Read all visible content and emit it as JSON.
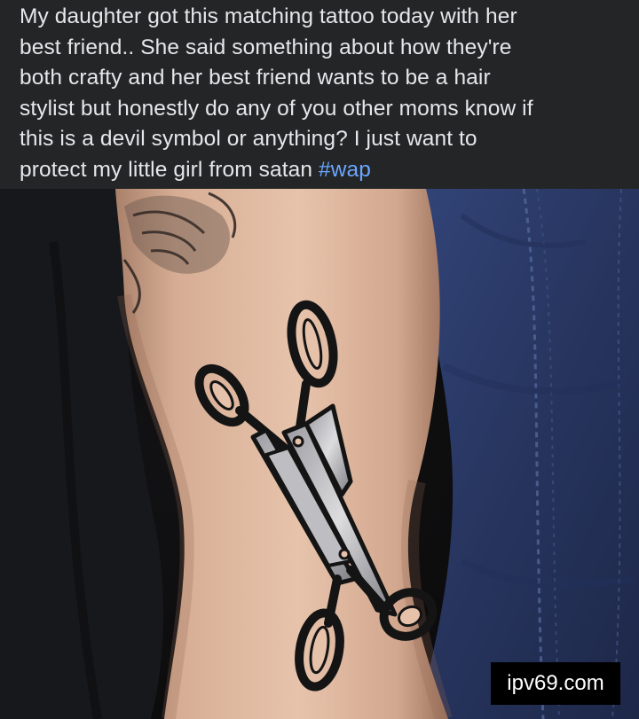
{
  "post": {
    "text_lines": [
      "My daughter got this matching tattoo today with her",
      "best friend.. She said something about how they're",
      "both crafty and her best friend wants to be a hair",
      "stylist but honestly do any of you other moms know if",
      "this is a devil symbol or anything? I just want to",
      "protect my little girl from satan "
    ],
    "hashtag": "#wap",
    "link_color": "#6aa6ff"
  },
  "photo": {
    "subject": "scissors-tattoo-on-arm",
    "colors": {
      "denim": "#2a3a66",
      "skin": "#e0b9a0",
      "ink": "#141414"
    }
  },
  "watermark": {
    "text": "ipv69.com"
  }
}
